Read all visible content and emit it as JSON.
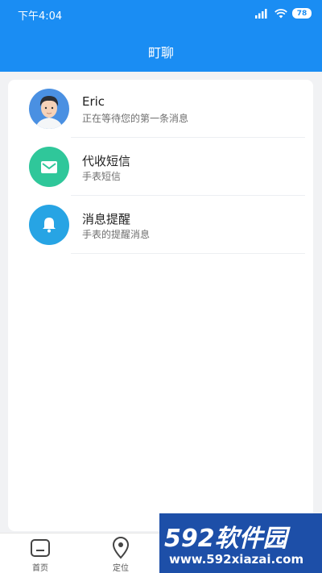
{
  "status_bar": {
    "time": "下午4:04",
    "battery": "78"
  },
  "header": {
    "title": "町聊"
  },
  "chats": [
    {
      "title": "Eric",
      "subtitle": "正在等待您的第一条消息",
      "icon": "user-avatar"
    },
    {
      "title": "代收短信",
      "subtitle": "手表短信",
      "icon": "envelope-icon",
      "color": "#2fc79a"
    },
    {
      "title": "消息提醒",
      "subtitle": "手表的提醒消息",
      "icon": "bell-icon",
      "color": "#27a4e4"
    }
  ],
  "tabbar": {
    "tabs": [
      {
        "label": "首页",
        "icon": "home-icon"
      },
      {
        "label": "定位",
        "icon": "location-pin-icon"
      }
    ]
  },
  "watermark": {
    "brand": "592软件园",
    "url": "www.592xiazai.com"
  }
}
